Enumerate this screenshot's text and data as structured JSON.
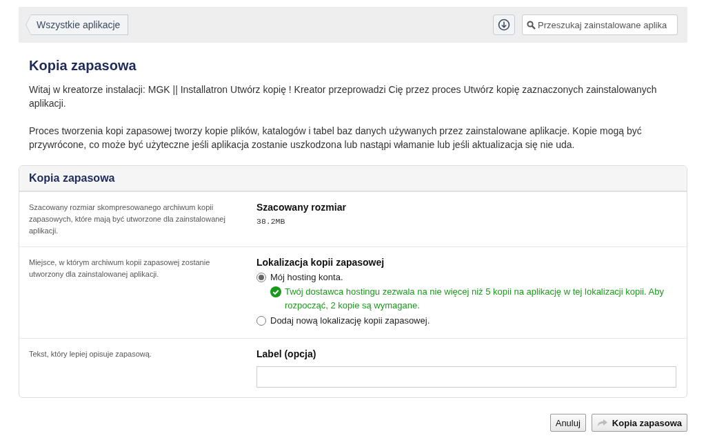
{
  "toolbar": {
    "back_button": "Wszystkie aplikacje",
    "search": {
      "placeholder": "Przeszukaj zainstalowane aplika"
    }
  },
  "page_title": "Kopia zapasowa",
  "intro": [
    "Witaj w kreatorze instalacji: MGK || Installatron Utwórz kopię ! Kreator przeprowadzi Cię przez proces Utwórz kopię zaznaczonych zainstalowanych aplikacji.",
    "Proces tworzenia kopi zapasowej tworzy kopie plików, katalogów i tabel baz danych używanych przez zainstalowane aplikacje. Kopie mogą być przywrócone, co może być użyteczne jeśli aplikacja zostanie uszkodzona lub nastąpi włamanie lub jeśli aktualizacja się nie uda."
  ],
  "panel": {
    "title": "Kopia zapasowa",
    "rows": [
      {
        "kind": "value",
        "description": "Szacowany rozmiar skompresowanego archiwum kopii zapasowych, które mają być utworzone dla zainstalowanej aplikacji.",
        "label": "Szacowany rozmiar",
        "value": "38.2MB"
      },
      {
        "kind": "radio",
        "description": "Miejsce, w którym archiwum kopii zapasowej zostanie utworzony dla zainstalowanej aplikacji.",
        "label": "Lokalizacja kopii zapasowej",
        "options": [
          {
            "label": "Mój hosting konta.",
            "selected": true,
            "note": "Twój dostawca hostingu zezwala na nie więcej niż 5 kopii na aplikację w tej lokalizacji kopii. Aby rozpocząć, 2 kopie są wymagane."
          },
          {
            "label": "Dodaj nową lokalizację kopii zapasowej.",
            "selected": false
          }
        ]
      },
      {
        "kind": "text",
        "description": "Tekst, który lepiej opisuje zapasową.",
        "label": "Label (opcja)"
      }
    ]
  },
  "buttons": [
    {
      "kind": "cancel",
      "label": "Anuluj"
    },
    {
      "kind": "submit",
      "label": "Kopia zapasowa"
    }
  ]
}
